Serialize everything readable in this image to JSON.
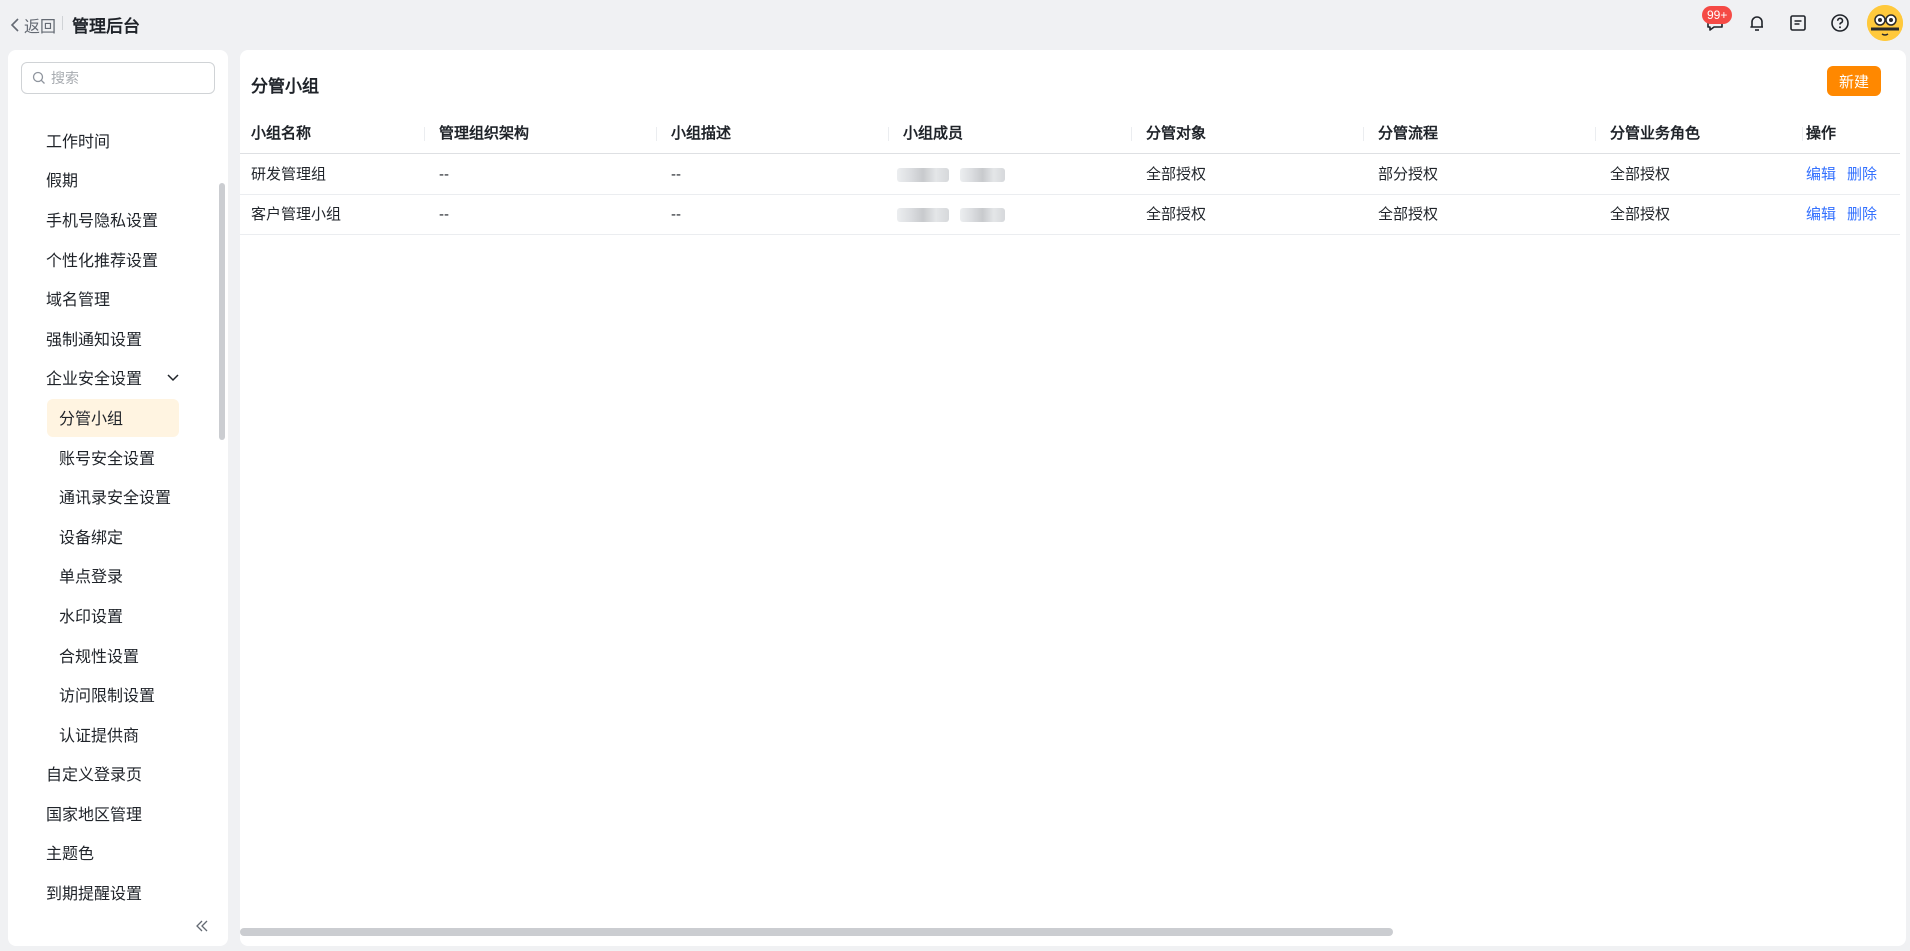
{
  "header": {
    "back_label": "返回",
    "title": "管理后台",
    "badge": "99+",
    "icons": [
      "chat-icon",
      "bell-icon",
      "notepad-icon",
      "help-icon"
    ]
  },
  "sidebar": {
    "search_placeholder": "搜索",
    "items": [
      {
        "label": "工作时间"
      },
      {
        "label": "假期"
      },
      {
        "label": "手机号隐私设置"
      },
      {
        "label": "个性化推荐设置"
      },
      {
        "label": "域名管理"
      },
      {
        "label": "强制通知设置"
      },
      {
        "label": "企业安全设置",
        "expanded": true
      },
      {
        "label": "分管小组",
        "sub": true,
        "active": true
      },
      {
        "label": "账号安全设置",
        "sub": true
      },
      {
        "label": "通讯录安全设置",
        "sub": true
      },
      {
        "label": "设备绑定",
        "sub": true
      },
      {
        "label": "单点登录",
        "sub": true
      },
      {
        "label": "水印设置",
        "sub": true
      },
      {
        "label": "合规性设置",
        "sub": true
      },
      {
        "label": "访问限制设置",
        "sub": true
      },
      {
        "label": "认证提供商",
        "sub": true
      },
      {
        "label": "自定义登录页"
      },
      {
        "label": "国家地区管理"
      },
      {
        "label": "主题色"
      },
      {
        "label": "到期提醒设置"
      }
    ]
  },
  "main": {
    "title": "分管小组",
    "new_button": "新建",
    "columns": [
      "小组名称",
      "管理组织架构",
      "小组描述",
      "小组成员",
      "分管对象",
      "分管流程",
      "分管业务角色",
      "操作"
    ],
    "rows": [
      {
        "name": "研发管理组",
        "org": "--",
        "desc": "--",
        "target": "全部授权",
        "process": "部分授权",
        "role": "全部授权",
        "edit": "编辑",
        "delete": "删除"
      },
      {
        "name": "客户管理小组",
        "org": "--",
        "desc": "--",
        "target": "全部授权",
        "process": "全部授权",
        "role": "全部授权",
        "edit": "编辑",
        "delete": "删除"
      }
    ]
  },
  "colors": {
    "accent": "#ff8800",
    "link": "#3370ff",
    "active_bg": "#fff4e1",
    "badge": "#f54a45"
  }
}
